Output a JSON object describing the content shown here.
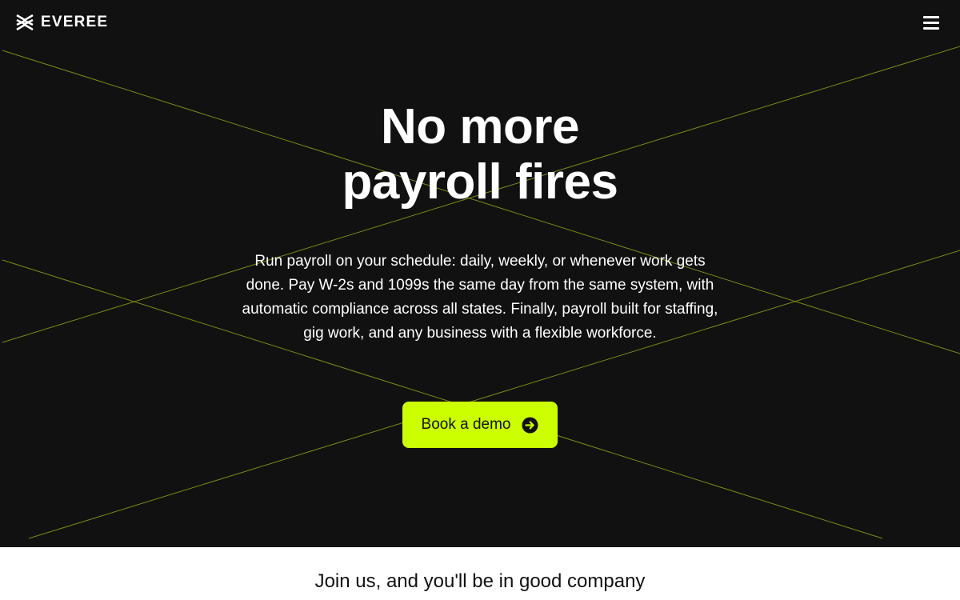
{
  "colors": {
    "hero_background": "#111112",
    "accent": "#ccff00",
    "decorative_lines": "#7d8a12",
    "text_light": "#ffffff",
    "text_dark": "#111112",
    "page_background": "#ffffff"
  },
  "nav": {
    "logo_text": "EVEREE",
    "logo_icon": "everee-logo-mark",
    "menu_icon": "hamburger-menu-icon"
  },
  "hero": {
    "headline_line1": "No more",
    "headline_line2": "payroll fires",
    "subtext": "Run payroll on your schedule: daily, weekly, or whenever work gets done. Pay W-2s and 1099s the same day from the same system, with automatic compliance across all states. Finally, payroll built for staffing, gig work, and any business with a flexible workforce.",
    "cta_label": "Book a demo",
    "cta_icon": "arrow-right-circle-icon"
  },
  "company_section": {
    "title": "Join us, and you'll be in good company"
  }
}
